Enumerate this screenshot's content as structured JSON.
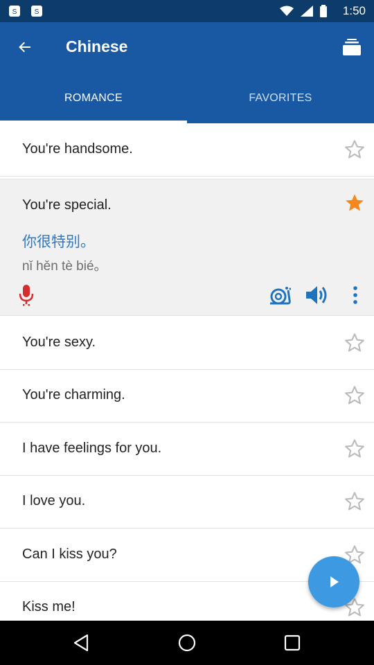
{
  "status_bar": {
    "time": "1:50"
  },
  "app_bar": {
    "title": "Chinese"
  },
  "tabs": [
    {
      "label": "ROMANCE",
      "active": true
    },
    {
      "label": "FAVORITES",
      "active": false
    }
  ],
  "colors": {
    "primary": "#1958a3",
    "status_bar": "#0d3c6b",
    "accent_star": "#f5871f",
    "mic_red": "#d32f2f",
    "fab": "#3d9ae2",
    "chinese_text": "#2f78c4"
  },
  "phrases": [
    {
      "text": "You're handsome.",
      "favorite": false
    },
    {
      "text": "You're special.",
      "favorite": true,
      "expanded": true,
      "chinese": "你很特别。",
      "pinyin": "nǐ hěn tè bié。"
    },
    {
      "text": "You're sexy.",
      "favorite": false
    },
    {
      "text": "You're charming.",
      "favorite": false
    },
    {
      "text": "I have feelings for you.",
      "favorite": false
    },
    {
      "text": "I love you.",
      "favorite": false
    },
    {
      "text": "Can I kiss you?",
      "favorite": false
    },
    {
      "text": "Kiss me!",
      "favorite": false
    }
  ],
  "icons": {
    "back": "arrow-left-icon",
    "cards": "flashcards-icon",
    "star_empty": "star-outline-icon",
    "star_filled": "star-filled-icon",
    "mic": "microphone-icon",
    "slow": "snail-icon",
    "speaker": "speaker-icon",
    "more": "more-vertical-icon",
    "play": "play-icon"
  }
}
